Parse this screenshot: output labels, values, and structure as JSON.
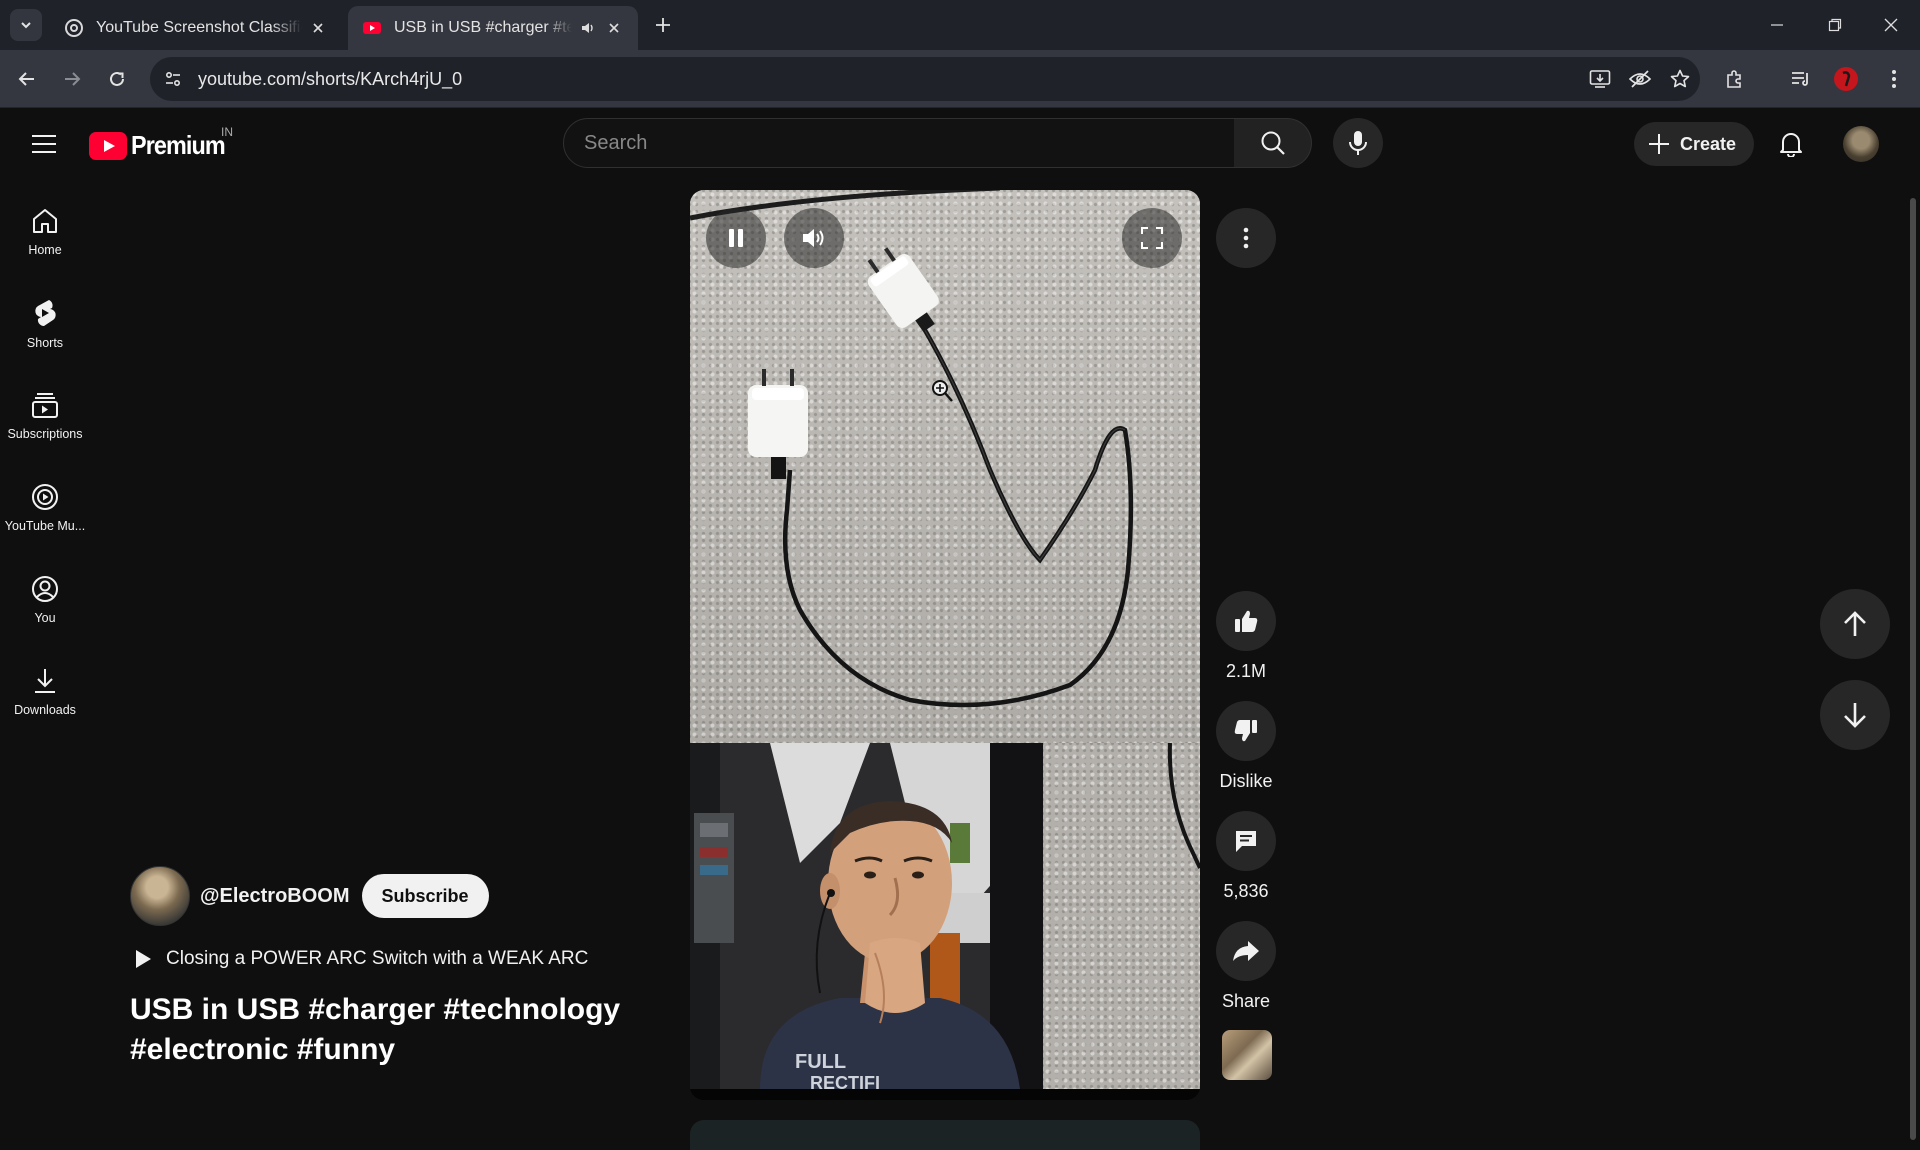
{
  "browser": {
    "tabs": [
      {
        "title": "YouTube Screenshot Classificati",
        "active": false,
        "favicon": "openai-icon"
      },
      {
        "title": "USB in USB #charger #techn",
        "active": true,
        "favicon": "youtube-icon",
        "audio": true
      }
    ],
    "url": "youtube.com/shorts/KArch4rjU_0"
  },
  "header": {
    "logo_text": "Premium",
    "country": "IN",
    "search_placeholder": "Search",
    "create_label": "Create"
  },
  "guide": {
    "items": [
      {
        "label": "Home",
        "icon": "home-icon"
      },
      {
        "label": "Shorts",
        "icon": "shorts-icon"
      },
      {
        "label": "Subscriptions",
        "icon": "subscriptions-icon"
      },
      {
        "label": "YouTube Mu...",
        "icon": "youtube-music-icon"
      },
      {
        "label": "You",
        "icon": "account-icon"
      },
      {
        "label": "Downloads",
        "icon": "download-icon"
      }
    ]
  },
  "short": {
    "channel": "@ElectroBOOM",
    "subscribe_label": "Subscribe",
    "related_video": "Closing a POWER ARC Switch with a WEAK ARC",
    "title": "USB in USB #charger #technology #electronic #funny",
    "overlay_text": "FULL RECTIFI"
  },
  "actions": {
    "likes": "2.1M",
    "dislike_label": "Dislike",
    "comments": "5,836",
    "share_label": "Share"
  },
  "colors": {
    "background": "#0f0f0f",
    "youtube_red": "#ff0033",
    "chip": "#272727",
    "tab_active": "#34373f",
    "tabstrip": "#1f2229"
  }
}
